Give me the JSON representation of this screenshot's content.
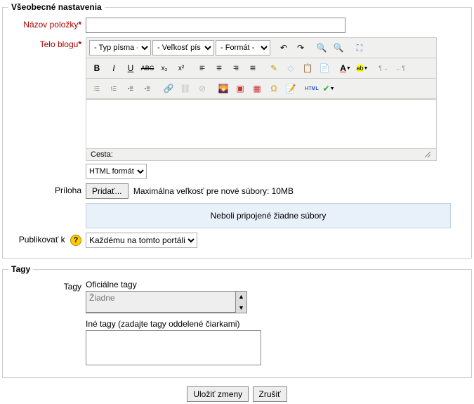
{
  "general": {
    "legend": "Všeobecné nastavenia",
    "title_label": "Názov položky",
    "body_label": "Telo blogu",
    "font_family_placeholder": "- Typ písma -",
    "font_size_placeholder": "- Veľkosť písma -",
    "format_placeholder": "- Formát -",
    "path_label": "Cesta:",
    "html_format": "HTML formát",
    "attachment_label": "Príloha",
    "add_button": "Pridať...",
    "max_size_text": "Maximálna veľkosť pre nové súbory: 10MB",
    "no_files_text": "Neboli pripojené žiadne súbory",
    "publish_label": "Publikovať k",
    "publish_value": "Každému na tomto portáli"
  },
  "icons": {
    "undo": "↶",
    "redo": "↷",
    "find": "🔍",
    "fullscreen": "⛶",
    "bold": "B",
    "italic": "I",
    "underline": "U",
    "strike": "ABC",
    "sub": "x₂",
    "sup": "x²",
    "alignl": "≡",
    "alignc": "≡",
    "alignr": "≡",
    "alignj": "≡",
    "clean": "✎",
    "remove": "◇",
    "paste": "📋",
    "pasteword": "📄",
    "fontcolor": "A",
    "hilite": "ab",
    "ltr": "¶→",
    "rtl": "←¶",
    "ul": "•",
    "ol": "1.",
    "outdent": "⇤",
    "indent": "⇥",
    "link": "🔗",
    "unlink": "⛓",
    "nolink": "⊘",
    "image": "🖼",
    "media": "▶",
    "table": "▦",
    "omega": "Ω",
    "edit": "✏",
    "html": "HTML",
    "spell": "✔"
  },
  "tags": {
    "legend": "Tagy",
    "label": "Tagy",
    "official_label": "Oficiálne tagy",
    "none_text": "Žiadne",
    "other_label": "Iné tagy (zadajte tagy oddelené čiarkami)"
  },
  "buttons": {
    "save": "Uložiť zmeny",
    "cancel": "Zrušiť"
  }
}
